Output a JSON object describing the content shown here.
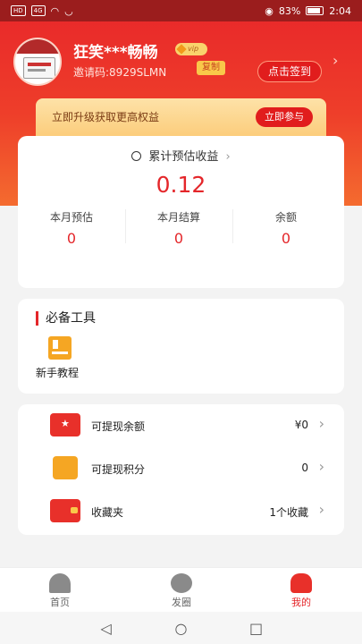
{
  "status_bar": {
    "left_chips": [
      "HD",
      "4G"
    ],
    "battery": "83%",
    "time": "2:04"
  },
  "profile": {
    "avatar_lines": [
      "福利升级"
    ],
    "username": "狂笑***畅畅",
    "vip_badge": "vip",
    "invite_code": "邀请码:8929SLMN",
    "copy_label": "复制",
    "signin_label": "点击签到"
  },
  "upgrade_banner": {
    "text": "立即升级获取更高权益",
    "button": "立即参与"
  },
  "earnings": {
    "title": "累计预估收益",
    "total": "0.12",
    "stats": [
      {
        "label": "本月预估",
        "value": "0"
      },
      {
        "label": "本月结算",
        "value": "0"
      },
      {
        "label": "余额",
        "value": "0"
      }
    ]
  },
  "tools": {
    "title": "必备工具",
    "items": [
      {
        "label": "新手教程",
        "icon": "tutorial-icon"
      }
    ]
  },
  "list": [
    {
      "label": "可提现余额",
      "value": "¥0",
      "icon": "wallet-star-icon"
    },
    {
      "label": "可提现积分",
      "value": "0",
      "icon": "points-icon"
    },
    {
      "label": "收藏夹",
      "value": "1个收藏",
      "icon": "favorites-icon"
    }
  ],
  "tabbar": [
    {
      "label": "首页",
      "icon": "home-icon"
    },
    {
      "label": "发圈",
      "icon": "discover-icon"
    },
    {
      "label": "我的",
      "icon": "me-icon"
    }
  ],
  "colors": {
    "accent": "#e4262a",
    "banner": "#fccd7c"
  }
}
